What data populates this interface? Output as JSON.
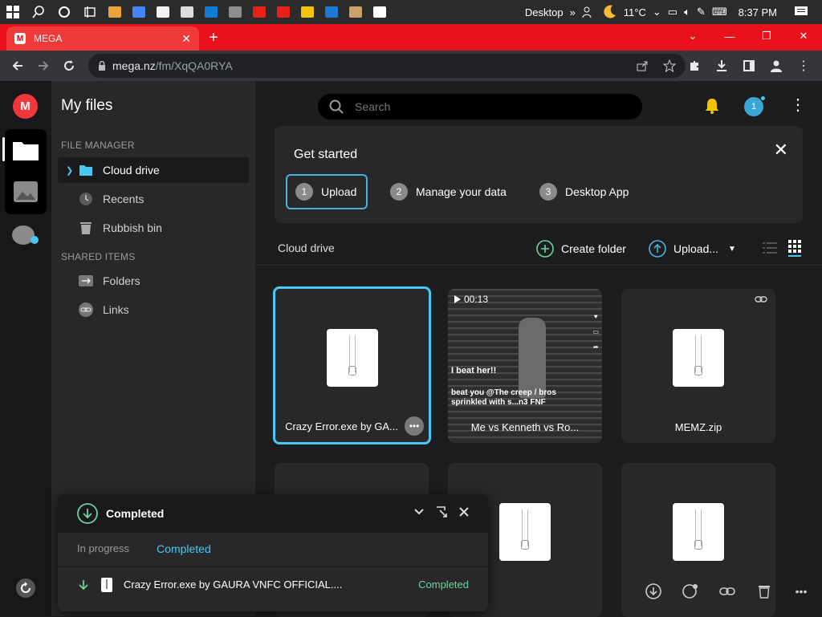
{
  "taskbar": {
    "desktop_label": "Desktop",
    "temperature": "11°C",
    "time": "8:37 PM",
    "app_colors": [
      "#e8a33a",
      "#4285f4",
      "#f2f2f2",
      "#dcdcdc",
      "#0f7dd6",
      "#8d8d8d",
      "#e62117",
      "#e62117",
      "#f4c20d",
      "#1f78d1",
      "#c9a36a",
      "#ffffff"
    ]
  },
  "browser": {
    "tab_title": "MEGA",
    "tab_favicon": "M",
    "url_host": "mega.nz",
    "url_path": "/fm/XqQA0RYA"
  },
  "app": {
    "logo": "M",
    "sidebar": {
      "title": "My files",
      "section_file_manager": "FILE MANAGER",
      "section_shared": "SHARED ITEMS",
      "items": [
        {
          "label": "Cloud drive",
          "icon": "folder-icon"
        },
        {
          "label": "Recents",
          "icon": "clock-icon"
        },
        {
          "label": "Rubbish bin",
          "icon": "trash-icon"
        },
        {
          "label": "Folders",
          "icon": "shared-folder-icon"
        },
        {
          "label": "Links",
          "icon": "link-icon"
        }
      ]
    },
    "search_placeholder": "Search",
    "avatar_badge": "1",
    "get_started": {
      "title": "Get started",
      "steps": [
        {
          "num": "1",
          "label": "Upload"
        },
        {
          "num": "2",
          "label": "Manage your data"
        },
        {
          "num": "3",
          "label": "Desktop App"
        }
      ]
    },
    "breadcrumb": "Cloud drive",
    "create_folder": "Create folder",
    "upload": "Upload...",
    "files": [
      {
        "name": "Crazy Error.exe by GA...",
        "type": "zip"
      },
      {
        "name": "Me vs Kenneth vs Ro...",
        "type": "video",
        "duration": "00:13",
        "overlay1": "I beat her!!",
        "overlay2": "beat you @The creep / bros sprinkled with s...n3 FNF"
      },
      {
        "name": "MEMZ.zip",
        "type": "zip"
      }
    ],
    "transfer": {
      "title": "Completed",
      "tab_in_progress": "In progress",
      "tab_completed": "Completed",
      "row_name": "Crazy Error.exe by GAURA VNFC OFFICIAL....",
      "row_status": "Completed"
    }
  }
}
